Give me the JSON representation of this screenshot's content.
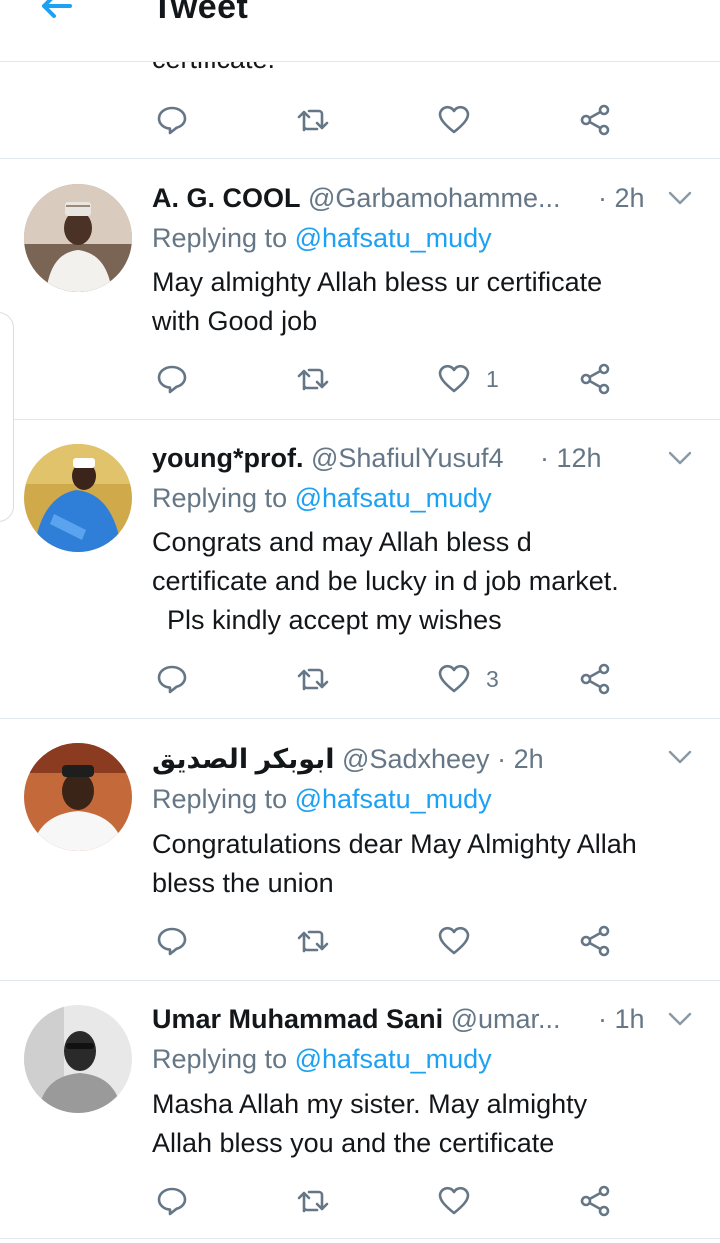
{
  "header": {
    "title": "Tweet"
  },
  "prev_tweet": {
    "text_tail": "certificate."
  },
  "tweets": [
    {
      "name": "A. G. COOL",
      "handle": "@Garbamohamme...",
      "dot": "·",
      "time": "2h",
      "replying_prefix": "Replying to",
      "replying_to": "@hafsatu_mudy",
      "body_lines": [
        "May almighty Allah bless ur certificate",
        "with Good job"
      ],
      "like_count": "1"
    },
    {
      "name": "young*prof.",
      "handle": "@ShafiulYusuf4",
      "dot": "·",
      "time": "12h",
      "replying_prefix": "Replying to",
      "replying_to": "@hafsatu_mudy",
      "body_lines": [
        "Congrats and may Allah bless d",
        "certificate and be lucky in d job market.",
        "  Pls kindly accept my wishes"
      ],
      "like_count": "3"
    },
    {
      "name": "ابوبكر الصديق",
      "handle": "@Sadxheey",
      "dot": "·",
      "time": "2h",
      "replying_prefix": "Replying to",
      "replying_to": "@hafsatu_mudy",
      "body_lines": [
        "Congratulations dear May Almighty Allah",
        "bless the union"
      ],
      "like_count": ""
    },
    {
      "name": "Umar Muhammad Sani",
      "handle": "@umar...",
      "dot": "·",
      "time": "1h",
      "replying_prefix": "Replying to",
      "replying_to": "@hafsatu_mudy",
      "body_lines": [
        "Masha Allah my sister. May almighty",
        "Allah bless you and the certificate"
      ],
      "like_count": ""
    }
  ],
  "icons": {
    "back": "arrow-left-icon",
    "reply": "reply-bubble-icon",
    "retweet": "retweet-icon",
    "like": "heart-icon",
    "share": "share-icon",
    "caret": "chevron-down-icon"
  },
  "colors": {
    "accent": "#1da1f2",
    "muted": "#657786",
    "text": "#14171a",
    "divider": "#e1e8ed"
  }
}
